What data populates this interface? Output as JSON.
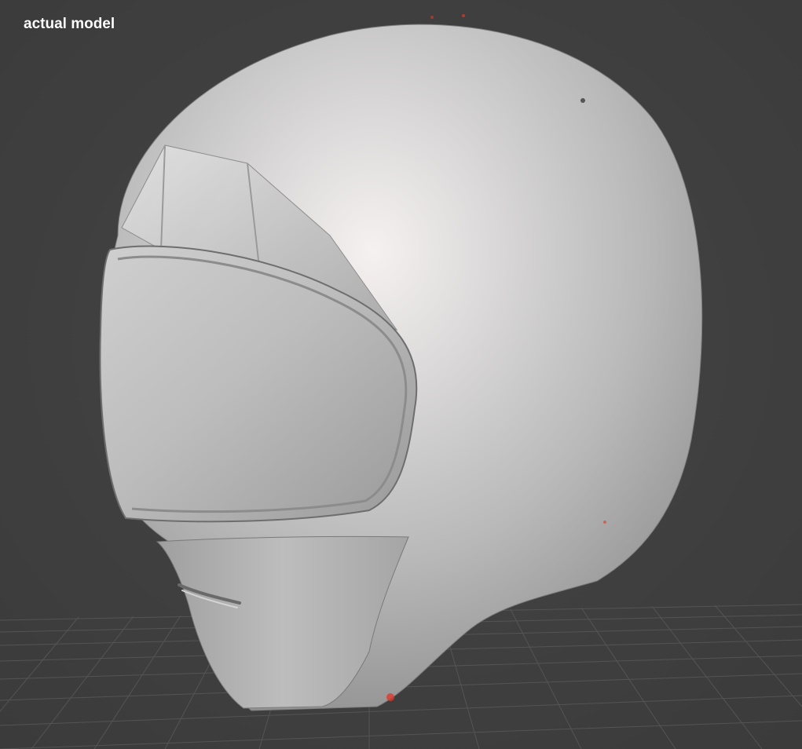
{
  "viewport": {
    "label": "actual model"
  },
  "scene": {
    "background_color": "#404040",
    "grid_color": "#5a5a5a",
    "model_color": "#bdbdbd",
    "highlight_color": "#f3eeee",
    "marker_color": "#e03a2a",
    "grid_visible": true
  }
}
